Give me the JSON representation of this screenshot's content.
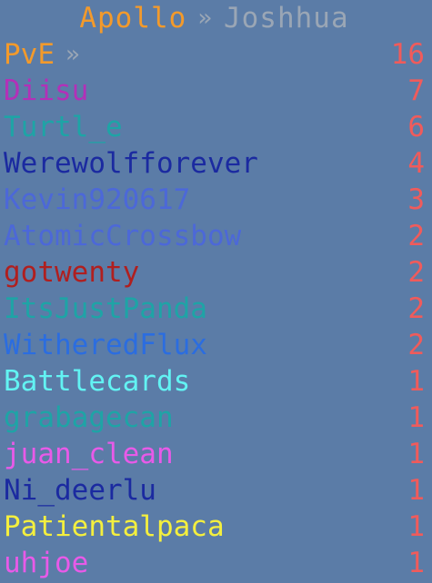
{
  "header": {
    "server": "Apollo",
    "separator": "»",
    "player": "Joshhua",
    "colors": {
      "server": "#f39a2b",
      "separator": "#9aa6b5",
      "player": "#9aa6b5"
    }
  },
  "category": {
    "label": "PvE",
    "arrow": "»",
    "score": "16",
    "colors": {
      "label": "#f39a2b",
      "arrow": "#9aa6b5",
      "score": "#f05b5b"
    }
  },
  "score_color": "#f05b5b",
  "entries": [
    {
      "name": "Diisu",
      "score": "7",
      "color": "#b330b8"
    },
    {
      "name": "Turtl_e",
      "score": "6",
      "color": "#1ea4a6"
    },
    {
      "name": "Werewolfforever",
      "score": "4",
      "color": "#1b2aa0"
    },
    {
      "name": "Kevin920617",
      "score": "3",
      "color": "#4c68d8"
    },
    {
      "name": "AtomicCrossbow",
      "score": "2",
      "color": "#4c68d8"
    },
    {
      "name": "gotwenty",
      "score": "2",
      "color": "#b01f1f"
    },
    {
      "name": "ItsJustPanda",
      "score": "2",
      "color": "#1ea4a6"
    },
    {
      "name": "WitheredFlux",
      "score": "2",
      "color": "#2b6de0"
    },
    {
      "name": "Battlecards",
      "score": "1",
      "color": "#62f3f3"
    },
    {
      "name": "grabagecan",
      "score": "1",
      "color": "#1ea4a6"
    },
    {
      "name": "juan_clean",
      "score": "1",
      "color": "#e85ae8"
    },
    {
      "name": "Ni_deerlu",
      "score": "1",
      "color": "#1b2aa0"
    },
    {
      "name": "Patientalpaca",
      "score": "1",
      "color": "#f4ef3e"
    },
    {
      "name": "uhjoe",
      "score": "1",
      "color": "#e85ae8"
    }
  ]
}
